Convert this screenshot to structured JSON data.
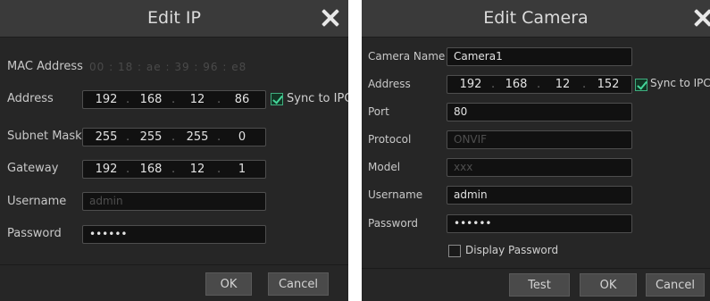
{
  "edit_ip": {
    "title": "Edit IP",
    "labels": {
      "mac": "MAC Address",
      "address": "Address",
      "subnet": "Subnet Mask",
      "gateway": "Gateway",
      "username": "Username",
      "password": "Password"
    },
    "mac_octets": [
      "00",
      "18",
      "ae",
      "39",
      "96",
      "e8"
    ],
    "address": [
      "192",
      "168",
      "12",
      "86"
    ],
    "subnet": [
      "255",
      "255",
      "255",
      "0"
    ],
    "gateway": [
      "192",
      "168",
      "12",
      "1"
    ],
    "username": "admin",
    "password": "••••••",
    "sync_label": "Sync to IPC",
    "sync_checked": true,
    "ok": "OK",
    "cancel": "Cancel"
  },
  "edit_camera": {
    "title": "Edit Camera",
    "labels": {
      "name": "Camera Name",
      "address": "Address",
      "port": "Port",
      "protocol": "Protocol",
      "model": "Model",
      "username": "Username",
      "password": "Password"
    },
    "name": "Camera1",
    "address": [
      "192",
      "168",
      "12",
      "152"
    ],
    "port": "80",
    "protocol": "ONVIF",
    "model": "xxx",
    "username": "admin",
    "password": "••••••",
    "sync_label": "Sync to IPC",
    "sync_checked": true,
    "display_password_label": "Display Password",
    "display_password_checked": false,
    "test": "Test",
    "ok": "OK",
    "cancel": "Cancel"
  },
  "colors": {
    "dialog_bg": "#262626",
    "titlebar_bg": "#3a3a3a",
    "field_bg": "#111111",
    "check_accent": "#44d69a"
  }
}
